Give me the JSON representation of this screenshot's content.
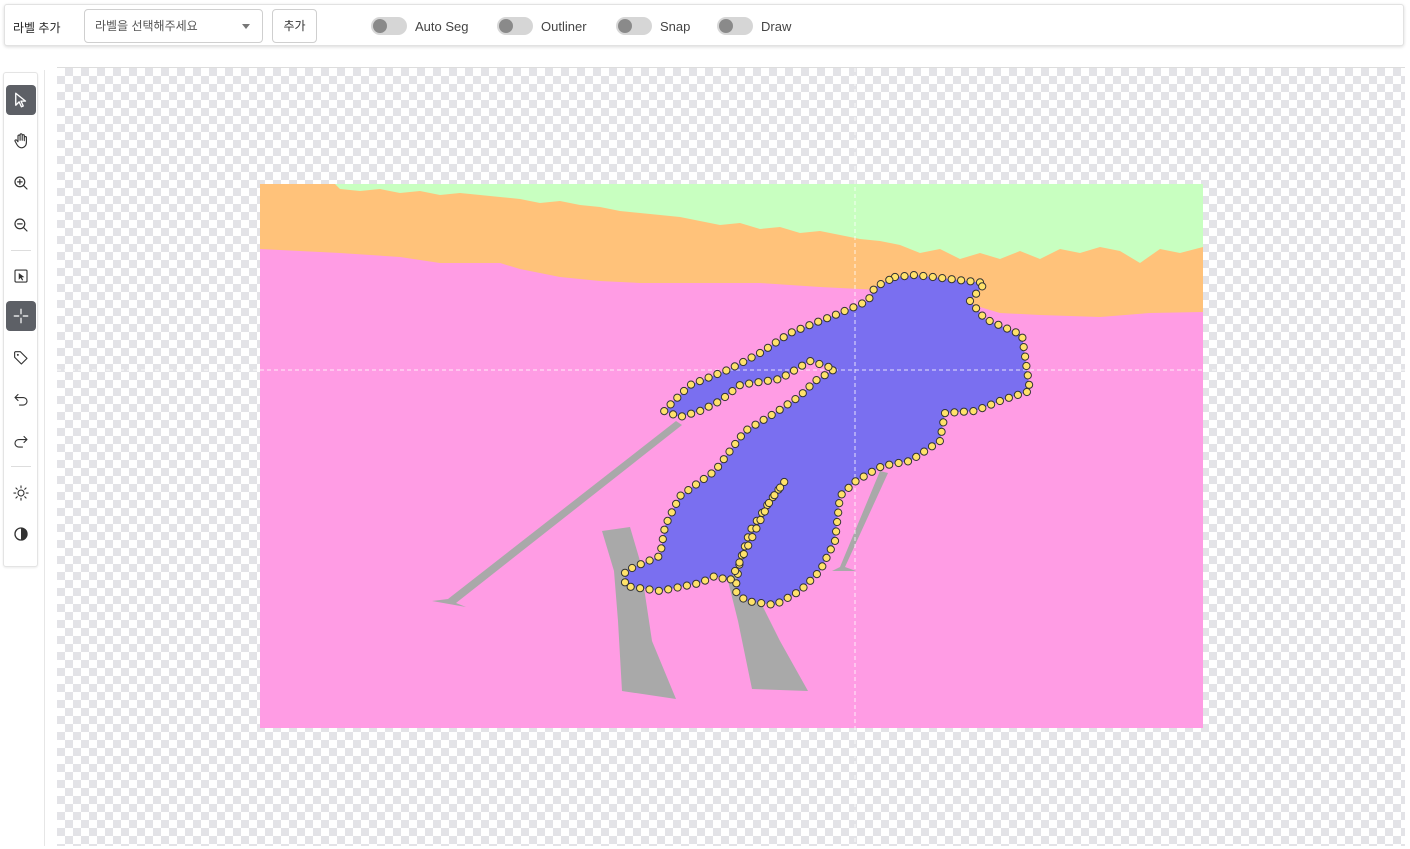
{
  "toolbar": {
    "label_add_title": "라벨 추가",
    "label_select_placeholder": "라벨을 선택해주세요",
    "add_button": "추가",
    "toggles": [
      {
        "label": "Auto Seg",
        "on": false
      },
      {
        "label": "Outliner",
        "on": false
      },
      {
        "label": "Snap",
        "on": false
      },
      {
        "label": "Draw",
        "on": false
      }
    ]
  },
  "tools": [
    {
      "name": "select-pointer-icon",
      "active": true
    },
    {
      "name": "hand-pan-icon",
      "active": false
    },
    {
      "name": "zoom-in-icon",
      "active": false
    },
    {
      "name": "zoom-out-icon",
      "active": false
    },
    {
      "name": "box-select-icon",
      "active": false
    },
    {
      "name": "crosshair-icon",
      "active": true
    },
    {
      "name": "tag-icon",
      "active": false
    },
    {
      "name": "undo-icon",
      "active": false
    },
    {
      "name": "redo-icon",
      "active": false
    },
    {
      "name": "brightness-icon",
      "active": false
    },
    {
      "name": "contrast-icon",
      "active": false
    }
  ],
  "colors": {
    "sky": "#c8ffc0",
    "trees": "#ffc27a",
    "snow": "#ff9ce4",
    "person": "#7a6ff0",
    "equipment": "#a9a9a9",
    "vertex_fill": "#ffe26a",
    "vertex_stroke": "#333333"
  }
}
